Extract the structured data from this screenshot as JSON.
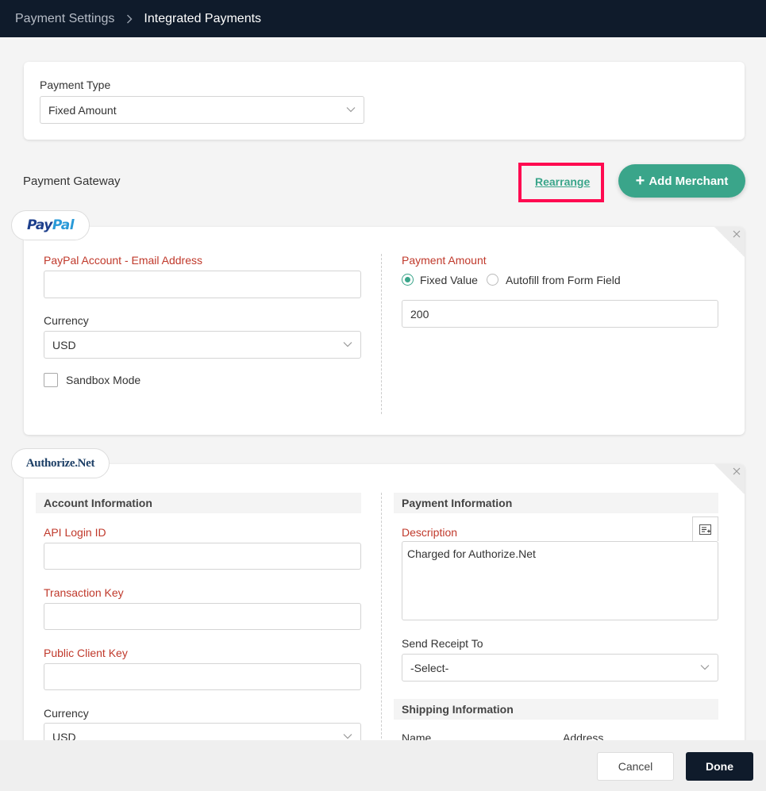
{
  "breadcrumb": {
    "parent": "Payment Settings",
    "current": "Integrated Payments"
  },
  "payment_type": {
    "label": "Payment Type",
    "selected": "Fixed Amount"
  },
  "gateway": {
    "title": "Payment Gateway",
    "rearrange_label": "Rearrange",
    "add_merchant_label": "Add Merchant"
  },
  "paypal": {
    "logo_part1": "Pay",
    "logo_part2": "Pal",
    "email_label": "PayPal Account - Email Address",
    "email_value": "",
    "currency_label": "Currency",
    "currency_selected": "USD",
    "sandbox_label": "Sandbox Mode",
    "sandbox_checked": false,
    "amount_label": "Payment Amount",
    "amount_options": [
      "Fixed Value",
      "Autofill from Form Field"
    ],
    "amount_selected": "Fixed Value",
    "amount_value": "200"
  },
  "authorize": {
    "logo": "Authorize.Net",
    "account_section": "Account Information",
    "api_login_label": "API Login ID",
    "api_login_value": "",
    "transaction_key_label": "Transaction Key",
    "transaction_key_value": "",
    "public_client_key_label": "Public Client Key",
    "public_client_key_value": "",
    "currency_label": "Currency",
    "currency_selected": "USD",
    "payment_section": "Payment Information",
    "description_label": "Description",
    "description_value": "Charged for Authorize.Net",
    "receipt_label": "Send Receipt To",
    "receipt_selected": "-Select-",
    "shipping_section": "Shipping Information",
    "shipping_columns": [
      "Name",
      "Address"
    ]
  },
  "footer": {
    "cancel_label": "Cancel",
    "done_label": "Done"
  },
  "colors": {
    "accent": "#3aa58a",
    "required_label": "#c0392b",
    "topbar": "#0f1b2b",
    "highlight": "#ff0a50"
  }
}
